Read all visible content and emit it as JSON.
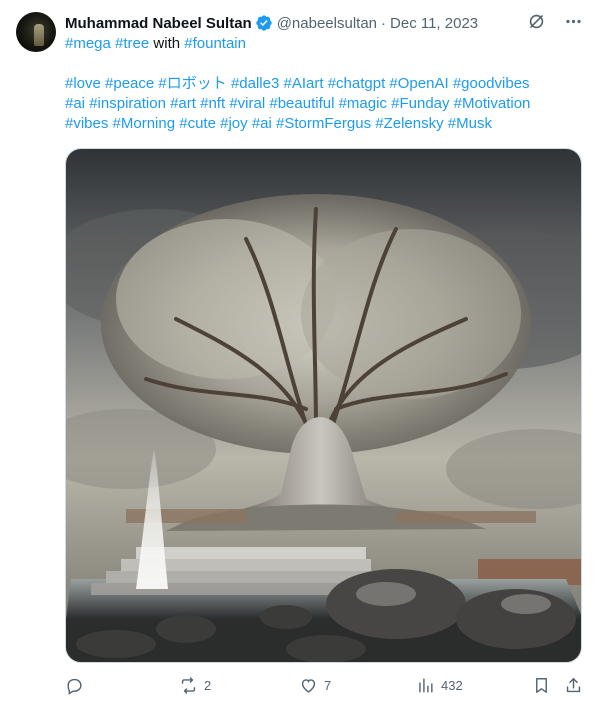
{
  "author": {
    "name": "Muhammad Nabeel Sultan",
    "handle": "@nabeelsultan",
    "separator": "·",
    "date": "Dec 11, 2023"
  },
  "tweet": {
    "line1": [
      {
        "t": "#mega",
        "tag": true
      },
      {
        "t": " ",
        "tag": false
      },
      {
        "t": "#tree",
        "tag": true
      },
      {
        "t": " with ",
        "tag": false
      },
      {
        "t": "#fountain",
        "tag": true
      }
    ],
    "line2": [
      {
        "t": " ",
        "tag": false
      },
      {
        "t": "#love",
        "tag": true
      },
      {
        "t": " ",
        "tag": false
      },
      {
        "t": "#peace",
        "tag": true
      },
      {
        "t": " ",
        "tag": false
      },
      {
        "t": "#ロボット",
        "tag": true
      },
      {
        "t": " ",
        "tag": false
      },
      {
        "t": "#dalle3",
        "tag": true
      },
      {
        "t": " ",
        "tag": false
      },
      {
        "t": "#AIart",
        "tag": true
      },
      {
        "t": " ",
        "tag": false
      },
      {
        "t": "#chatgpt",
        "tag": true
      },
      {
        "t": " ",
        "tag": false
      },
      {
        "t": "#OpenAI",
        "tag": true
      },
      {
        "t": " ",
        "tag": false
      },
      {
        "t": "#goodvibes",
        "tag": true
      }
    ],
    "line3": [
      {
        "t": "#ai",
        "tag": true
      },
      {
        "t": " ",
        "tag": false
      },
      {
        "t": "#inspiration",
        "tag": true
      },
      {
        "t": " ",
        "tag": false
      },
      {
        "t": "#art",
        "tag": true
      },
      {
        "t": " ",
        "tag": false
      },
      {
        "t": "#nft",
        "tag": true
      },
      {
        "t": " ",
        "tag": false
      },
      {
        "t": "#viral",
        "tag": true
      },
      {
        "t": " ",
        "tag": false
      },
      {
        "t": "#beautiful",
        "tag": true
      },
      {
        "t": " ",
        "tag": false
      },
      {
        "t": "#magic",
        "tag": true
      },
      {
        "t": " ",
        "tag": false
      },
      {
        "t": "#Funday",
        "tag": true
      },
      {
        "t": " ",
        "tag": false
      },
      {
        "t": "#Motivation",
        "tag": true
      }
    ],
    "line4": [
      {
        "t": "#vibes",
        "tag": true
      },
      {
        "t": " ",
        "tag": false
      },
      {
        "t": "#Morning",
        "tag": true
      },
      {
        "t": " ",
        "tag": false
      },
      {
        "t": "#cute",
        "tag": true
      },
      {
        "t": " ",
        "tag": false
      },
      {
        "t": "#joy",
        "tag": true
      },
      {
        "t": " ",
        "tag": false
      },
      {
        "t": "#ai",
        "tag": true
      },
      {
        "t": "  ",
        "tag": false
      },
      {
        "t": "#StormFergus",
        "tag": true
      },
      {
        "t": " ",
        "tag": false
      },
      {
        "t": "#Zelensky",
        "tag": true
      },
      {
        "t": " ",
        "tag": false
      },
      {
        "t": "#Musk",
        "tag": true
      }
    ]
  },
  "actions": {
    "replies": "",
    "reposts": "2",
    "likes": "7",
    "views": "432"
  },
  "colors": {
    "link": "#1d9bf0",
    "muted": "#536471",
    "verified": "#1d9bf0"
  },
  "icons": [
    "verified-badge-icon",
    "grok-icon",
    "more-icon",
    "reply-icon",
    "repost-icon",
    "like-icon",
    "views-icon",
    "bookmark-icon",
    "share-icon"
  ]
}
